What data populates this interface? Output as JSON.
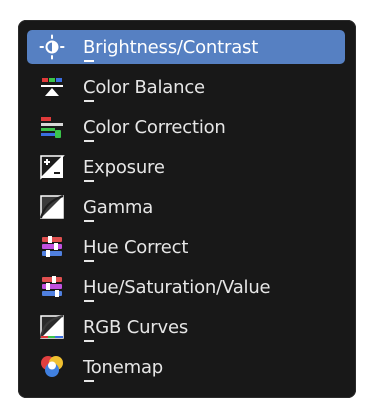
{
  "menu": {
    "items": [
      {
        "label": "Brightness/Contrast",
        "icon": "brightness-contrast-icon",
        "active": true
      },
      {
        "label": "Color Balance",
        "icon": "color-balance-icon",
        "active": false
      },
      {
        "label": "Color Correction",
        "icon": "color-correction-icon",
        "active": false
      },
      {
        "label": "Exposure",
        "icon": "exposure-icon",
        "active": false
      },
      {
        "label": "Gamma",
        "icon": "gamma-icon",
        "active": false
      },
      {
        "label": "Hue Correct",
        "icon": "hue-correct-icon",
        "active": false
      },
      {
        "label": "Hue/Saturation/Value",
        "icon": "hue-saturation-value-icon",
        "active": false
      },
      {
        "label": "RGB Curves",
        "icon": "rgb-curves-icon",
        "active": false
      },
      {
        "label": "Tonemap",
        "icon": "tonemap-icon",
        "active": false
      }
    ]
  },
  "colors": {
    "menu_bg": "#181818",
    "highlight": "#5680c2",
    "text": "#e6e6e6"
  }
}
